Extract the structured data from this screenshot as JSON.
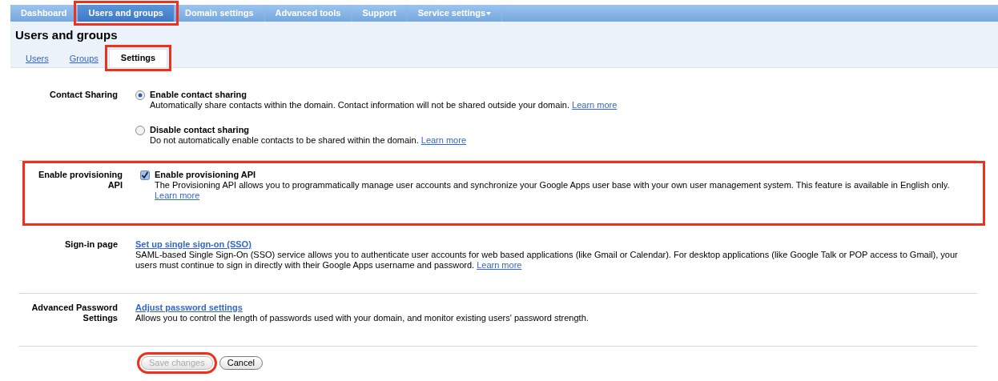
{
  "nav_tabs": [
    {
      "label": "Dashboard",
      "selected": false,
      "highlighted": false,
      "has_menu": false
    },
    {
      "label": "Users and groups",
      "selected": true,
      "highlighted": true,
      "has_menu": false
    },
    {
      "label": "Domain settings",
      "selected": false,
      "highlighted": false,
      "has_menu": false
    },
    {
      "label": "Advanced tools",
      "selected": false,
      "highlighted": false,
      "has_menu": false
    },
    {
      "label": "Support",
      "selected": false,
      "highlighted": false,
      "has_menu": false
    },
    {
      "label": "Service settings",
      "selected": false,
      "highlighted": false,
      "has_menu": true
    }
  ],
  "page_title": "Users and groups",
  "sub_tabs": [
    {
      "label": "Users",
      "selected": false,
      "highlighted": false
    },
    {
      "label": "Groups",
      "selected": false,
      "highlighted": false
    },
    {
      "label": "Settings",
      "selected": true,
      "highlighted": true
    }
  ],
  "sections": [
    {
      "label": "Contact Sharing",
      "kind": "radio",
      "highlighted": false,
      "options": [
        {
          "title": "Enable contact sharing",
          "selected": true,
          "description": "Automatically share contacts within the domain. Contact information will not be shared outside your domain.",
          "link": "Learn more",
          "link_break": false
        },
        {
          "title": "Disable contact sharing",
          "selected": false,
          "description": "Do not automatically enable contacts to be shared within the domain.",
          "link": "Learn more",
          "link_break": false
        }
      ]
    },
    {
      "label": "Enable provisioning API",
      "kind": "checkbox",
      "highlighted": true,
      "options": [
        {
          "title": "Enable provisioning API",
          "checked": true,
          "description": "The Provisioning API allows you to programmatically manage user accounts and synchronize your Google Apps user base with your own user management system. This feature is available in English only.",
          "link": "Learn more",
          "link_break": true
        }
      ]
    },
    {
      "label": "Sign-in page",
      "kind": "link",
      "highlighted": false,
      "options": [
        {
          "title": "Set up single sign-on (SSO)",
          "description": "SAML-based Single Sign-On (SSO) service allows you to authenticate user accounts for web based applications (like Gmail or Calendar). For desktop applications (like Google Talk or POP access to Gmail), your users must continue to sign in directly with their Google Apps username and password.",
          "link": "Learn more",
          "link_break": false
        }
      ]
    },
    {
      "label": "Advanced Password Settings",
      "kind": "link",
      "highlighted": false,
      "options": [
        {
          "title": "Adjust password settings",
          "description": "Allows you to control the length of passwords used with your domain, and monitor existing users' password strength."
        }
      ]
    }
  ],
  "buttons": [
    {
      "label": "Save changes",
      "disabled": true,
      "highlighted": true
    },
    {
      "label": "Cancel",
      "disabled": false,
      "highlighted": false
    }
  ]
}
